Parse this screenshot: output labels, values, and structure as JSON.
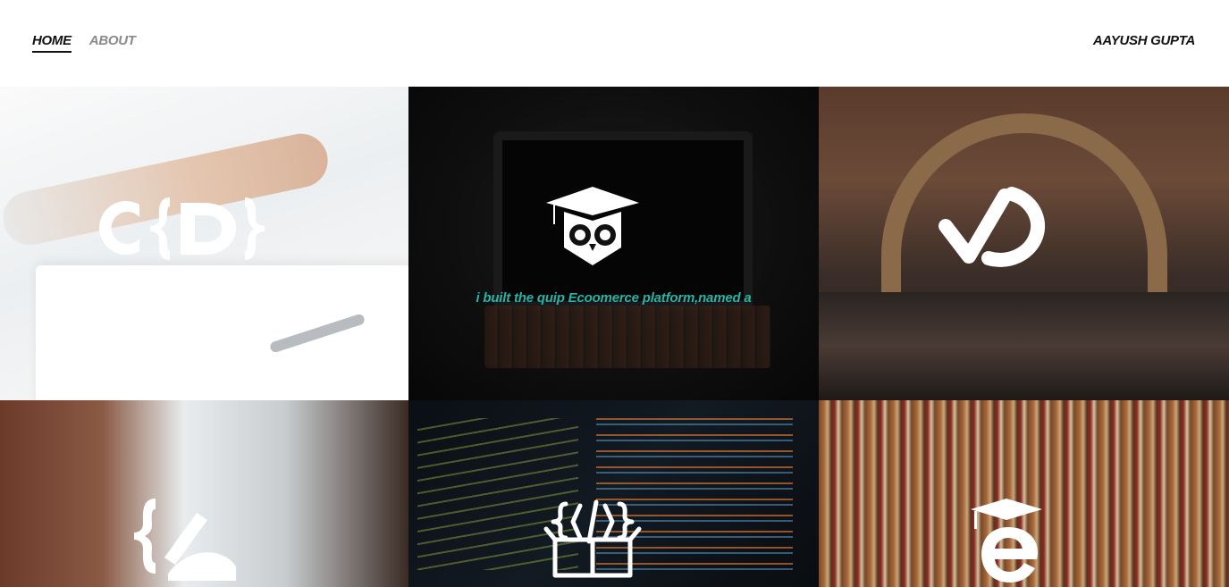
{
  "nav": {
    "home_label": "HOME",
    "about_label": "ABOUT"
  },
  "brand": {
    "name": "AAYUSH GUPTA"
  },
  "tiles": [
    {
      "icon": "cd-logo-icon"
    },
    {
      "icon": "owl-graduate-icon",
      "caption": "i built the quip Ecoomerce platform,named a"
    },
    {
      "icon": "checkmark-logo-icon"
    },
    {
      "icon": "curly-brace-logo-icon"
    },
    {
      "icon": "code-box-icon"
    },
    {
      "icon": "graduation-e-icon"
    }
  ],
  "colors": {
    "caption": "#26b5a8",
    "nav_active": "#111111",
    "nav_inactive": "#8a8a8a"
  }
}
